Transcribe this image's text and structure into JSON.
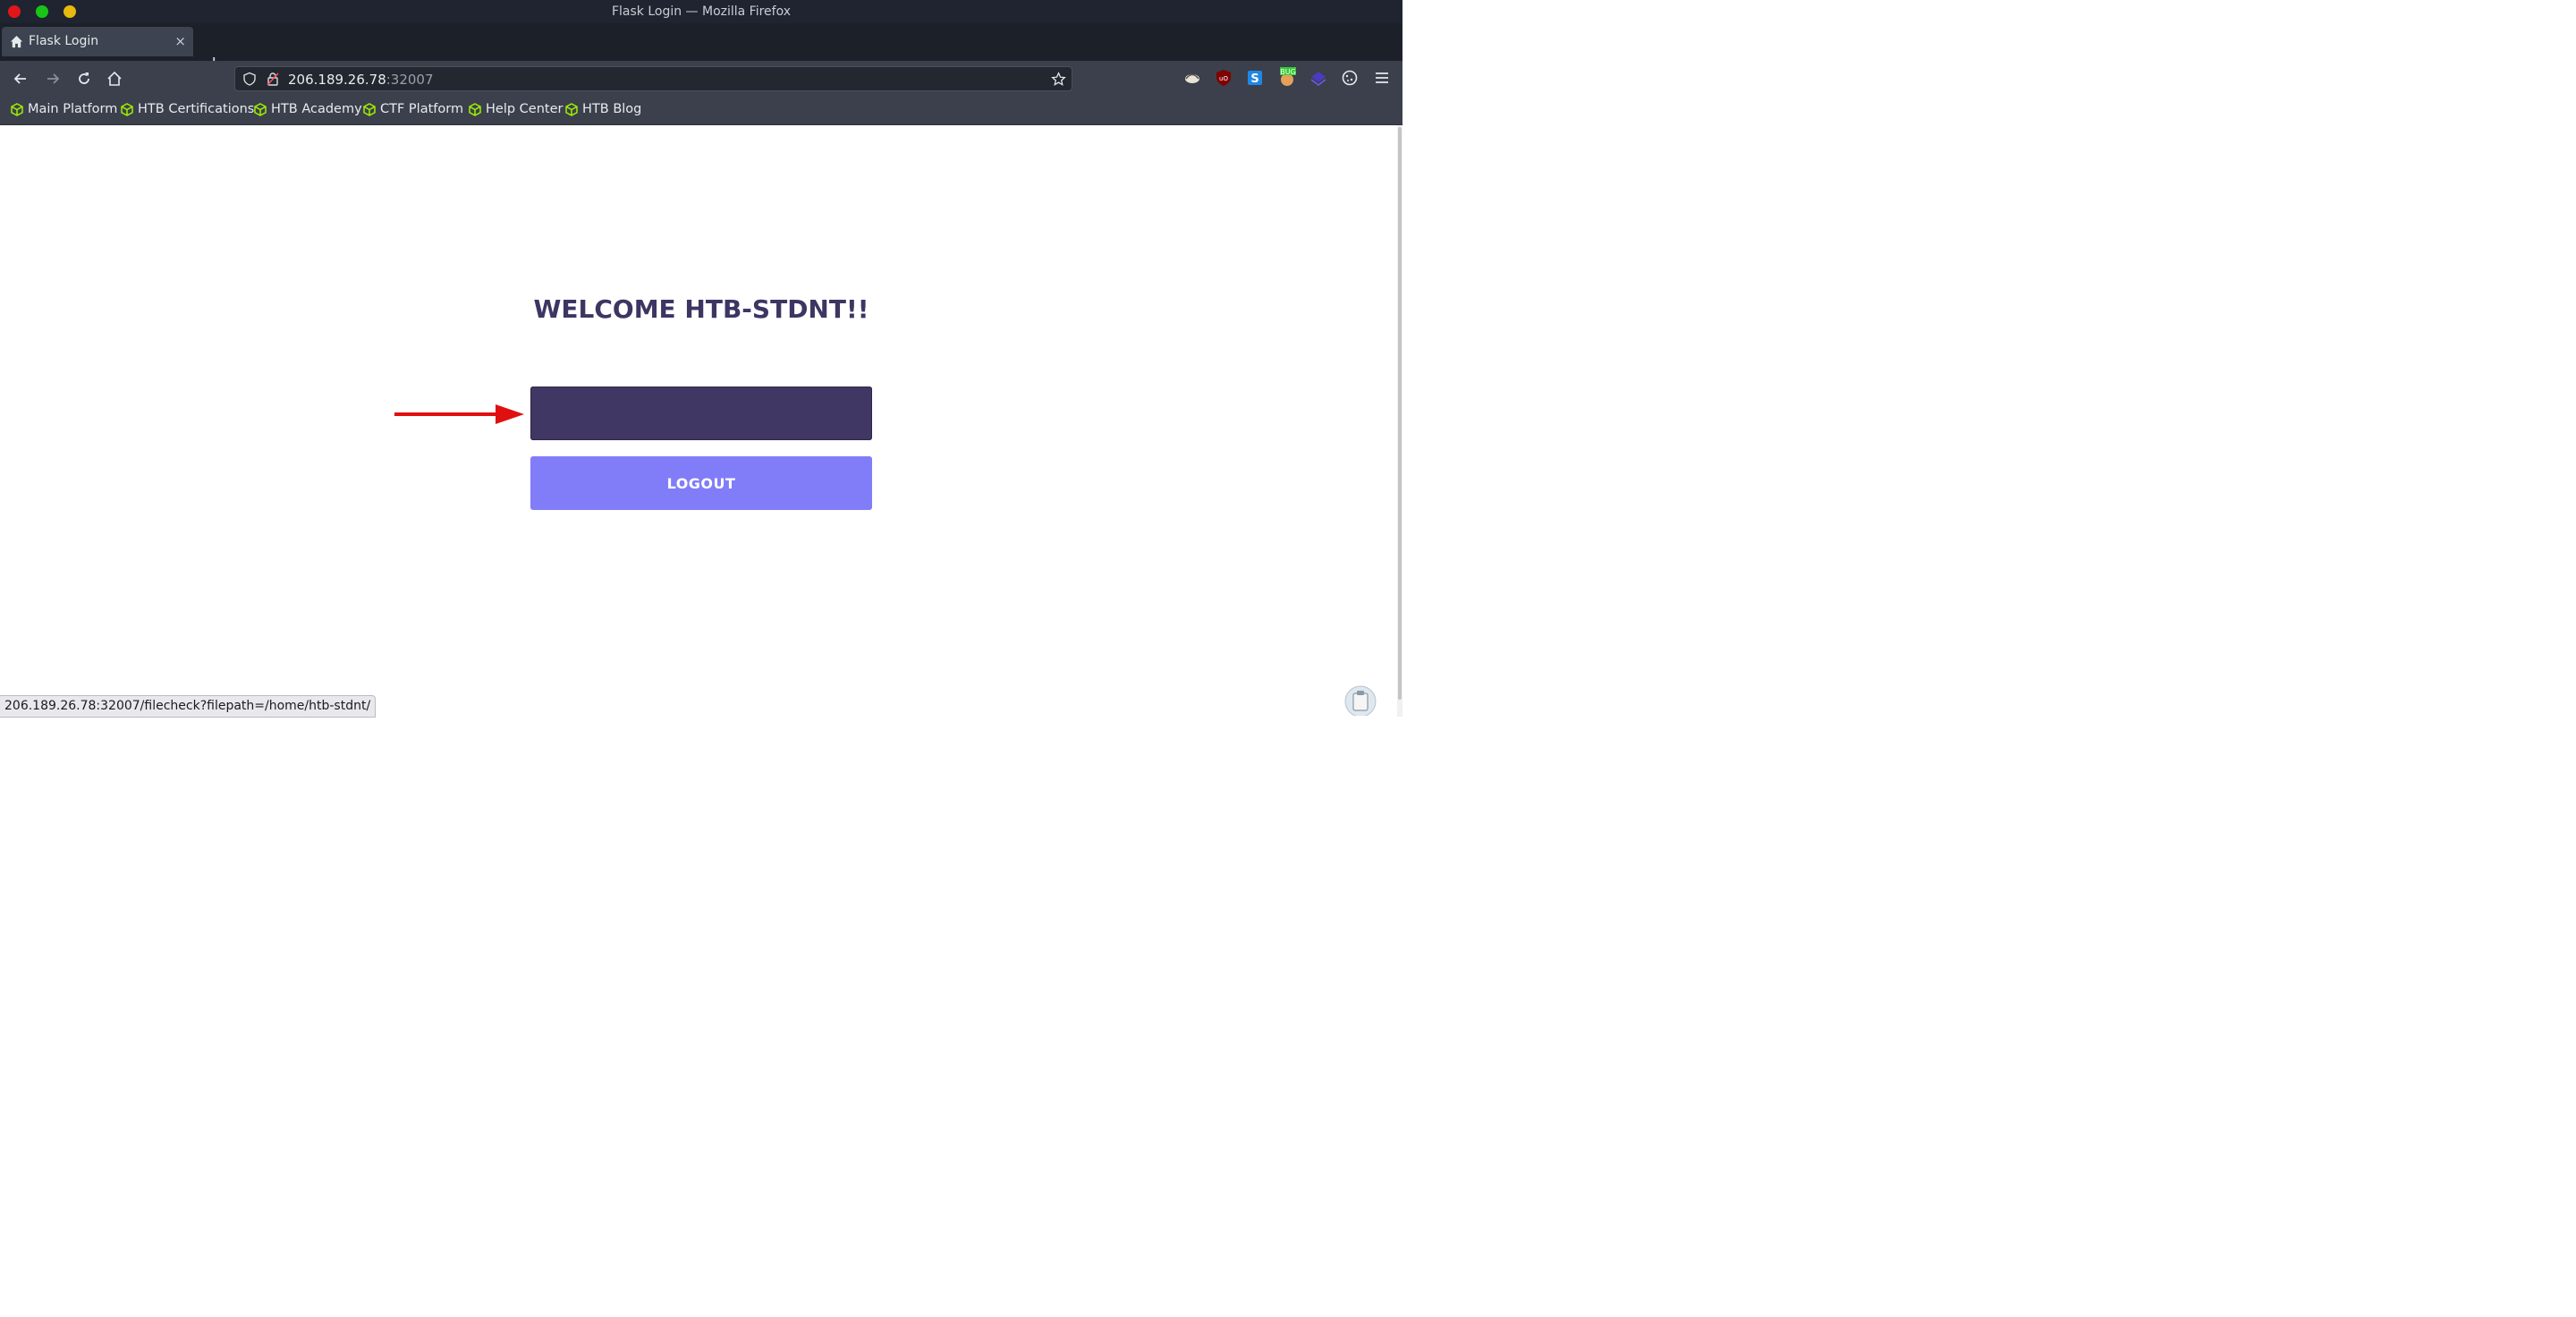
{
  "window": {
    "title": "Flask Login — Mozilla Firefox"
  },
  "tab": {
    "label": "Flask Login",
    "close_glyph": "×",
    "new_tab_glyph": "+"
  },
  "urlbar": {
    "host": "206.189.26.78",
    "port": ":32007"
  },
  "bookmarks": [
    {
      "label": "Main Platform"
    },
    {
      "label": "HTB Certifications"
    },
    {
      "label": "HTB Academy"
    },
    {
      "label": "CTF Platform"
    },
    {
      "label": "Help Center"
    },
    {
      "label": "HTB Blog"
    }
  ],
  "page": {
    "heading": "WELCOME HTB-STDNT!!",
    "file_button_label": "",
    "logout_label": "LOGOUT"
  },
  "status": {
    "link_url": "206.189.26.78:32007/filecheck?filepath=/home/htb-stdnt/"
  },
  "colors": {
    "heading": "#3d3663",
    "file_button": "#403764",
    "logout_button": "#817df9",
    "annotation_arrow": "#e01010",
    "bookmark_icon": "#9fef00"
  },
  "icons": {
    "tab": "home-icon",
    "nav": [
      "back-icon",
      "forward-icon",
      "reload-icon",
      "home-icon"
    ],
    "urlbar": [
      "shield-icon",
      "insecure-lock-icon",
      "star-icon"
    ],
    "extensions": [
      "extension-1-icon",
      "ublock-icon",
      "s-extension-icon",
      "bug-extension-icon",
      "stack-extension-icon",
      "cookie-icon",
      "menu-icon"
    ]
  }
}
